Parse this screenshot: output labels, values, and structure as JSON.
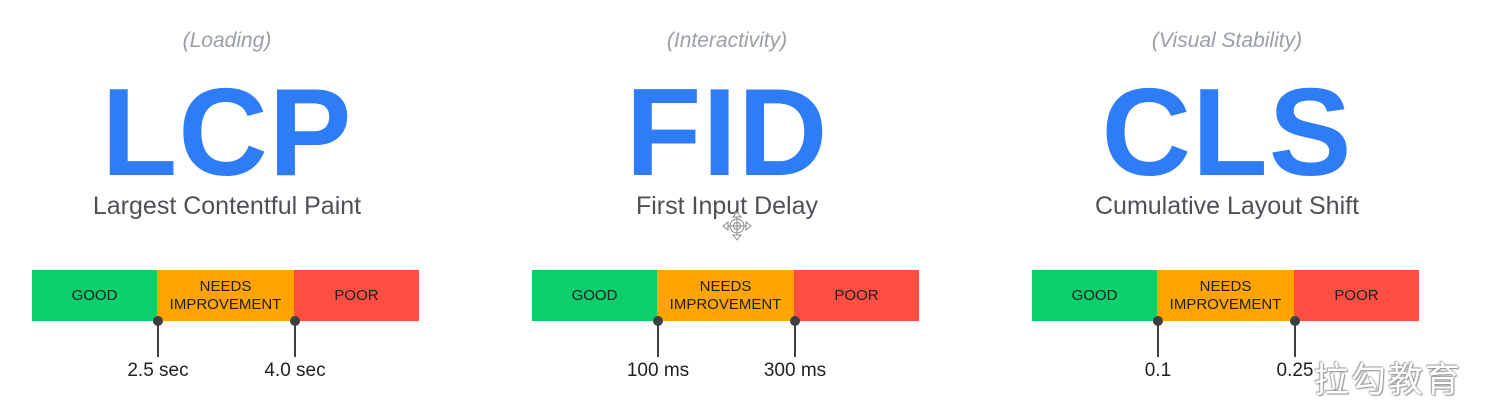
{
  "colors": {
    "good": "#0cce6b",
    "needs_improvement": "#ffa400",
    "poor": "#ff4e42",
    "accent": "#2f7df6"
  },
  "metrics": [
    {
      "category": "(Loading)",
      "abbr": "LCP",
      "name": "Largest Contentful Paint",
      "segments": [
        "GOOD",
        "NEEDS\nIMPROVEMENT",
        "POOR"
      ],
      "thresholds": [
        "2.5 sec",
        "4.0 sec"
      ]
    },
    {
      "category": "(Interactivity)",
      "abbr": "FID",
      "name": "First Input Delay",
      "segments": [
        "GOOD",
        "NEEDS\nIMPROVEMENT",
        "POOR"
      ],
      "thresholds": [
        "100 ms",
        "300 ms"
      ]
    },
    {
      "category": "(Visual Stability)",
      "abbr": "CLS",
      "name": "Cumulative Layout Shift",
      "segments": [
        "GOOD",
        "NEEDS\nIMPROVEMENT",
        "POOR"
      ],
      "thresholds": [
        "0.1",
        "0.25"
      ]
    }
  ],
  "cursor": {
    "icon": "move-cursor-icon"
  },
  "watermark": "拉勾教育"
}
